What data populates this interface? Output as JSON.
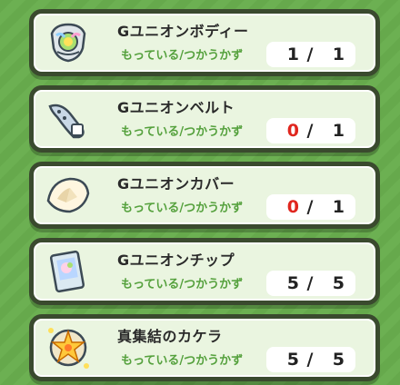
{
  "items": [
    {
      "name": "Gユニオンボディー",
      "owned_label": "もっている",
      "separator": "/",
      "needed_label": "つかうかず",
      "have": "1",
      "slash": "/",
      "need": "1",
      "have_zero": false,
      "icon": "armor-body-icon"
    },
    {
      "name": "Gユニオンベルト",
      "owned_label": "もっている",
      "separator": "/",
      "needed_label": "つかうかず",
      "have": "0",
      "slash": "/",
      "need": "1",
      "have_zero": true,
      "icon": "belt-icon"
    },
    {
      "name": "Gユニオンカバー",
      "owned_label": "もっている",
      "separator": "/",
      "needed_label": "つかうかず",
      "have": "0",
      "slash": "/",
      "need": "1",
      "have_zero": true,
      "icon": "shell-cover-icon"
    },
    {
      "name": "Gユニオンチップ",
      "owned_label": "もっている",
      "separator": "/",
      "needed_label": "つかうかず",
      "have": "5",
      "slash": "/",
      "need": "5",
      "have_zero": false,
      "icon": "card-chip-icon"
    },
    {
      "name": "真集結のカケラ",
      "owned_label": "もっている",
      "separator": "/",
      "needed_label": "つかうかず",
      "have": "5",
      "slash": "/",
      "need": "5",
      "have_zero": false,
      "icon": "star-fragment-icon"
    }
  ],
  "colors": {
    "background": "#66a94c",
    "card_fill": "#eaf5e0",
    "card_border": "#3a4a2e",
    "label_green": "#55a13d",
    "zero_red": "#e0261e"
  }
}
